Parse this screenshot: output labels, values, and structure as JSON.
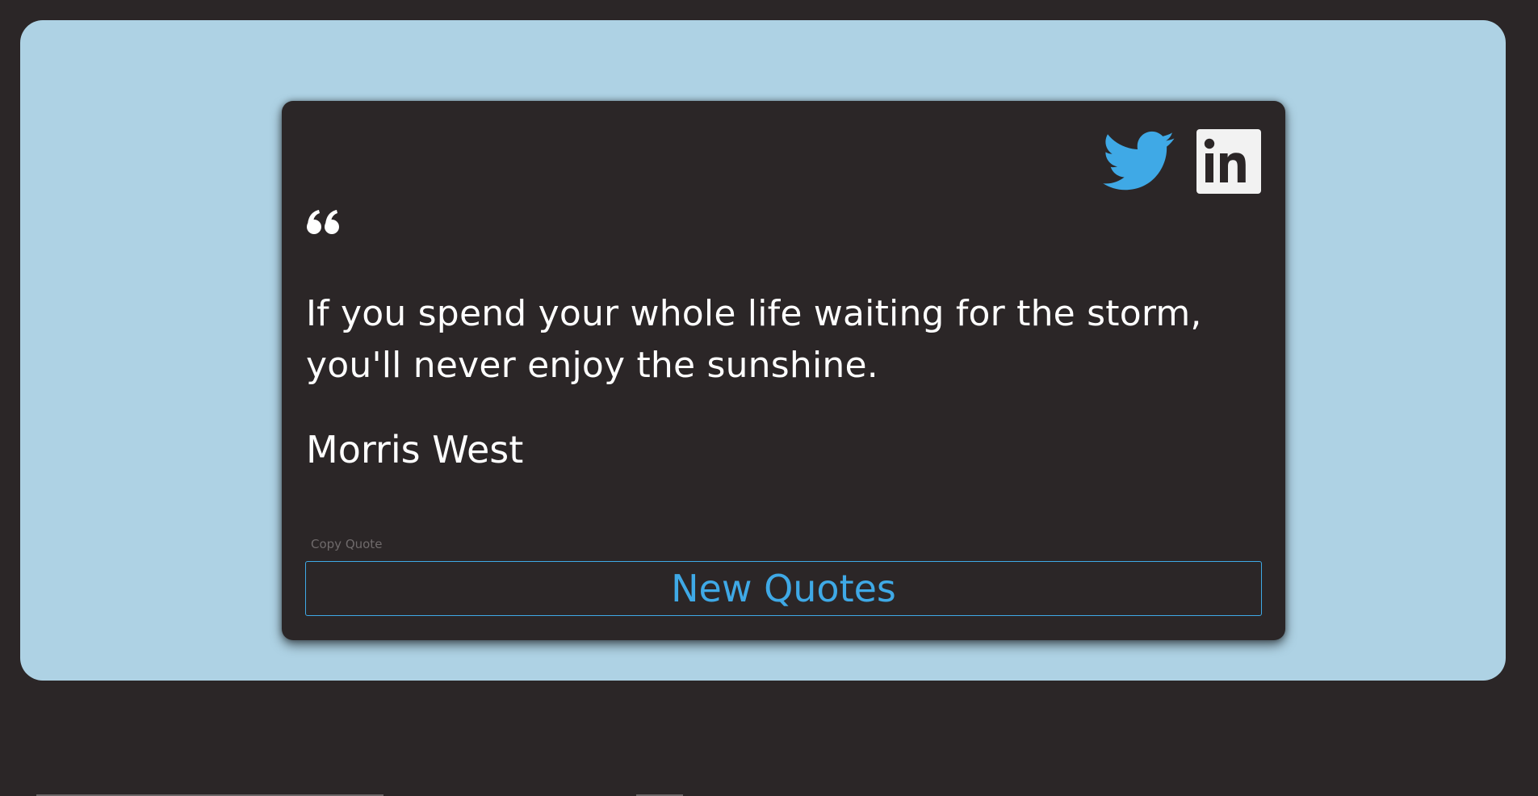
{
  "colors": {
    "page_background": "#2b2627",
    "panel_background": "#aed2e4",
    "card_background": "#2b2627",
    "accent": "#3fa9e6",
    "text": "#ffffff",
    "muted_text": "#6f6a6b"
  },
  "socials": [
    {
      "icon": "twitter-icon",
      "color": "#3fa9e6"
    },
    {
      "icon": "linkedin-icon",
      "color": "#f2f2f2"
    }
  ],
  "quote": {
    "icon": "quote-left-icon",
    "text": "If you spend your whole life waiting for the storm, you'll never enjoy the sunshine.",
    "author": "Morris West"
  },
  "actions": {
    "copy_label": "Copy Quote",
    "new_label": "New Quotes"
  }
}
